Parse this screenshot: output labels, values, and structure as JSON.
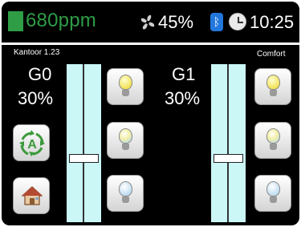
{
  "status": {
    "co2": "680ppm",
    "humidity": "45%",
    "time": "10:25",
    "co2_color": "#2e9d46"
  },
  "room": {
    "name": "Kantoor 1.23",
    "mode": "Comfort"
  },
  "groups": [
    {
      "name": "G0",
      "level_text": "30%",
      "slider_fraction": 0.6
    },
    {
      "name": "G1",
      "level_text": "30%",
      "slider_fraction": 0.6
    }
  ],
  "buttons": {
    "auto_icon": "auto-mode-icon",
    "home_icon": "home-icon",
    "bulb_icons": [
      "bulb-on-icon",
      "bulb-dim-icon",
      "bulb-off-icon"
    ]
  },
  "colors": {
    "slider_bg": "#cbf7f7",
    "background": "#000000",
    "text": "#ffffff"
  }
}
